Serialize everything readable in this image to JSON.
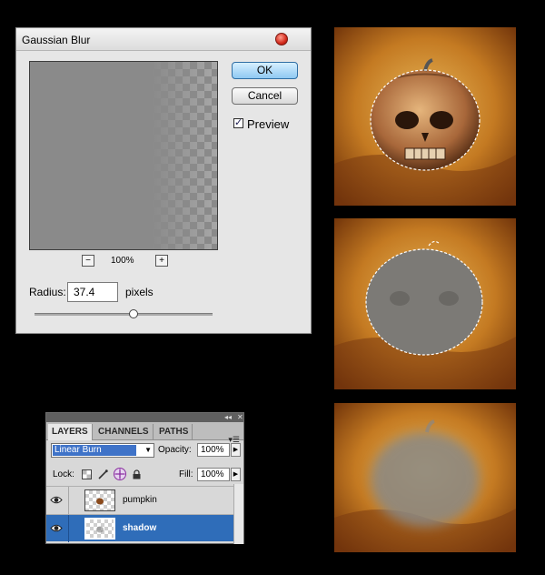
{
  "dialog": {
    "title": "Gaussian Blur",
    "ok_label": "OK",
    "cancel_label": "Cancel",
    "preview_checked": true,
    "preview_label": "Preview",
    "zoom_out": "−",
    "zoom_in": "+",
    "zoom_value": "100%",
    "radius_label": "Radius:",
    "radius_value": "37.4",
    "radius_unit": "pixels"
  },
  "layers_panel": {
    "tabs": [
      {
        "label": "LAYERS",
        "active": true
      },
      {
        "label": "CHANNELS",
        "active": false
      },
      {
        "label": "PATHS",
        "active": false
      }
    ],
    "blend_mode": "Linear Burn",
    "opacity_label": "Opacity:",
    "opacity_value": "100%",
    "lock_label": "Lock:",
    "fill_label": "Fill:",
    "fill_value": "100%",
    "layers": [
      {
        "name": "pumpkin",
        "visible": true,
        "selected": false
      },
      {
        "name": "shadow",
        "visible": true,
        "selected": true
      }
    ]
  },
  "colors": {
    "selection_blue": "#2f6db9",
    "ok_button": "#8fc9f2",
    "grunge_orange": "#c4741f"
  }
}
